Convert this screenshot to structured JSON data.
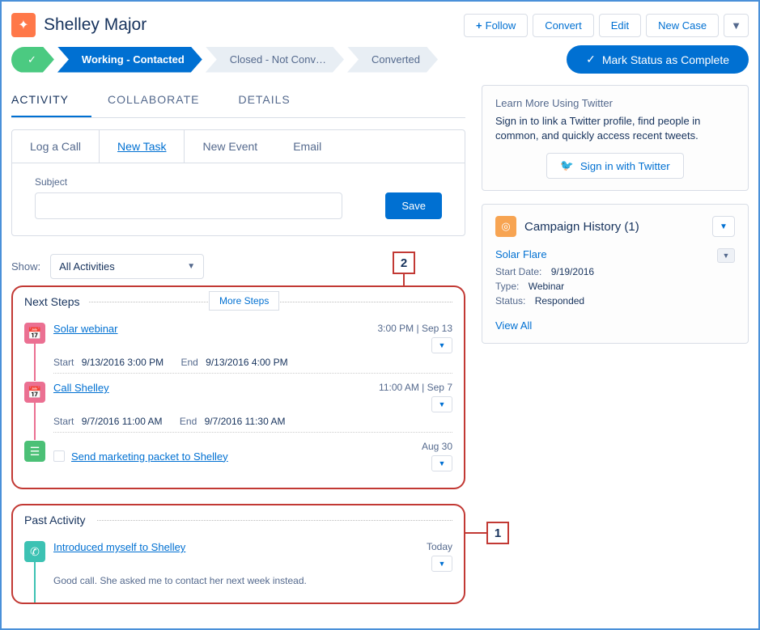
{
  "header": {
    "title": "Shelley Major",
    "actions": {
      "follow": "Follow",
      "convert": "Convert",
      "edit": "Edit",
      "new_case": "New Case"
    }
  },
  "path": {
    "steps": [
      {
        "label": "✓",
        "state": "done"
      },
      {
        "label": "Working - Contacted",
        "state": "current"
      },
      {
        "label": "Closed - Not Conv…",
        "state": ""
      },
      {
        "label": "Converted",
        "state": ""
      }
    ],
    "complete_button": "Mark Status as Complete"
  },
  "main_tabs": {
    "activity": "ACTIVITY",
    "collaborate": "COLLABORATE",
    "details": "DETAILS"
  },
  "composer": {
    "tabs": {
      "log_call": "Log a Call",
      "new_task": "New Task",
      "new_event": "New Event",
      "email": "Email"
    },
    "subject_label": "Subject",
    "subject_value": "",
    "save": "Save"
  },
  "filter": {
    "label": "Show:",
    "value": "All Activities"
  },
  "callouts": {
    "one": "1",
    "two": "2"
  },
  "next_steps": {
    "heading": "Next Steps",
    "more": "More Steps",
    "items": [
      {
        "title": "Solar webinar",
        "when": "3:00 PM | Sep 13",
        "start": "9/13/2016 3:00 PM",
        "end": "9/13/2016 4:00 PM",
        "type": "event"
      },
      {
        "title": "Call Shelley",
        "when": "11:00 AM | Sep 7",
        "start": "9/7/2016 11:00 AM",
        "end": "9/7/2016 11:30 AM",
        "type": "event"
      },
      {
        "title": "Send marketing packet to Shelley",
        "when": "Aug 30",
        "type": "task"
      }
    ]
  },
  "past_activity": {
    "heading": "Past Activity",
    "items": [
      {
        "title": "Introduced myself to Shelley",
        "when": "Today",
        "note": "Good call. She asked me to contact her next week instead.",
        "type": "call"
      }
    ]
  },
  "labels": {
    "start": "Start",
    "end": "End"
  },
  "twitter_card": {
    "heading": "Learn More Using Twitter",
    "text": "Sign in to link a Twitter profile, find people in common, and quickly access recent tweets.",
    "button": "Sign in with Twitter"
  },
  "campaign_card": {
    "title": "Campaign History (1)",
    "item": {
      "name": "Solar Flare",
      "fields": {
        "start_date_label": "Start Date:",
        "start_date": "9/19/2016",
        "type_label": "Type:",
        "type": "Webinar",
        "status_label": "Status:",
        "status": "Responded"
      }
    },
    "view_all": "View All"
  }
}
